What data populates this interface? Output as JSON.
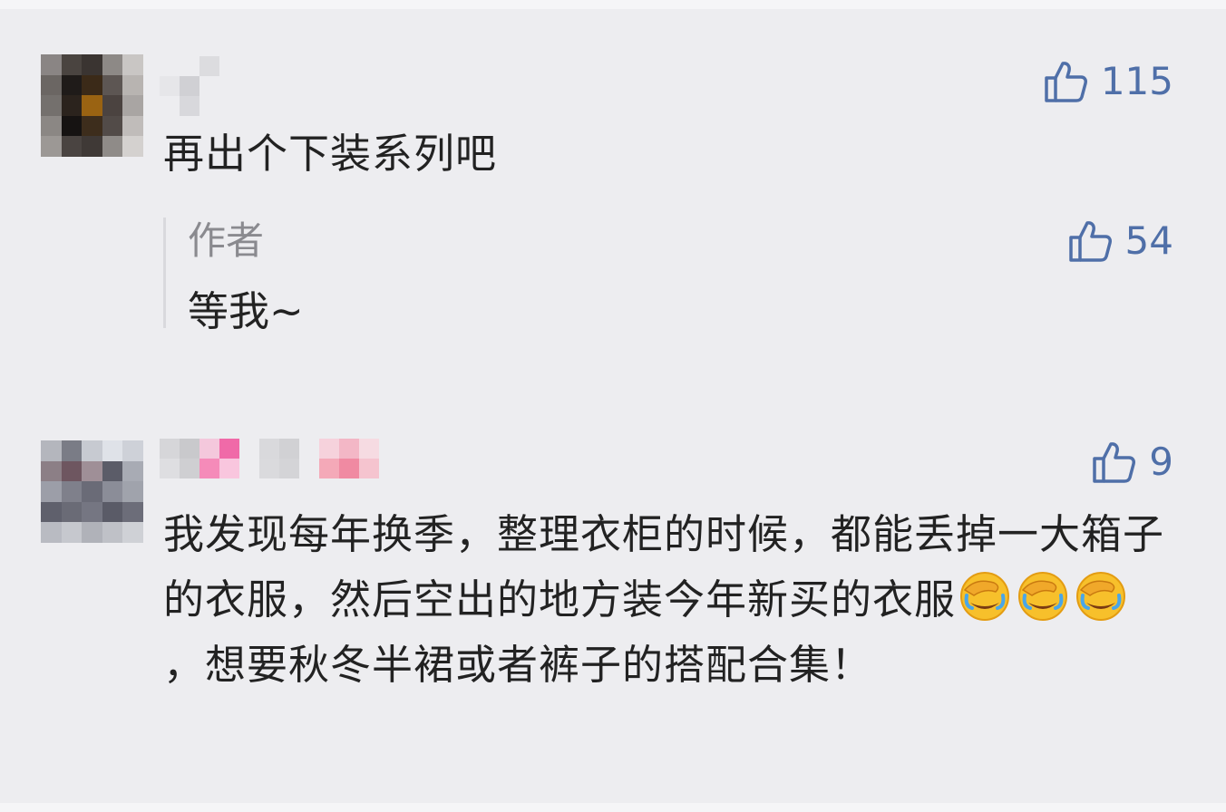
{
  "comments": [
    {
      "text": "再出个下装系列吧",
      "likes": "115",
      "reply": {
        "author": "作者",
        "text": "等我~",
        "likes": "54"
      }
    },
    {
      "text_part1": "我发现每年换季，整理衣柜的时候，都能丢掉一大箱子的衣服，然后空出的地方装今年新买的衣服",
      "emoji_name": "face-palm-crying-icon",
      "text_part2": "，想要秋冬半裙或者裤子的搭配合集！",
      "likes": "9"
    }
  ],
  "colors": {
    "like": "#4f6fa8",
    "text": "#222222",
    "author": "#8a8a8f"
  }
}
